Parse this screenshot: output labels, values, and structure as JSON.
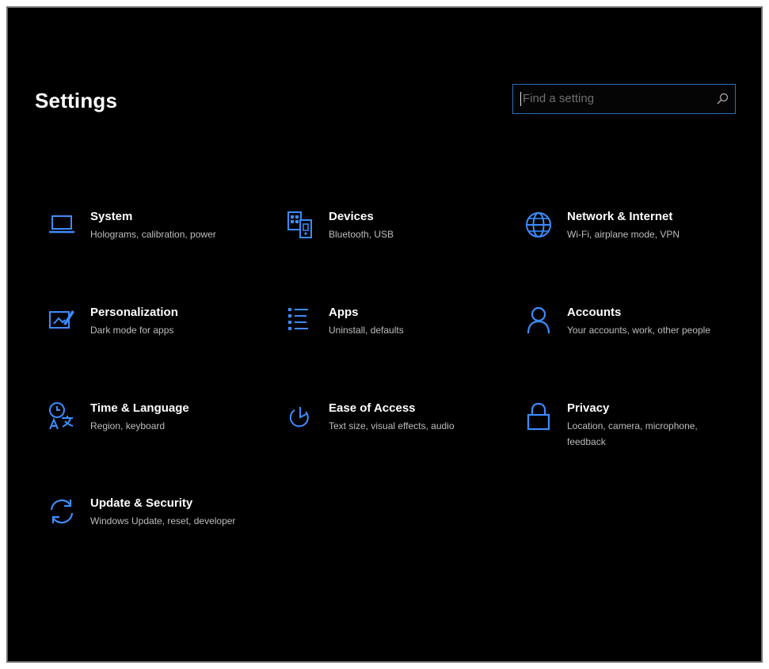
{
  "app": {
    "title": "Settings"
  },
  "search": {
    "placeholder": "Find a setting",
    "value": ""
  },
  "colors": {
    "accent": "#3c8cff",
    "background": "#000000",
    "text": "#ffffff",
    "subtext": "#bdbdbd"
  },
  "tiles": [
    {
      "label": "System",
      "desc": "Holograms, calibration, power",
      "icon": "laptop-icon"
    },
    {
      "label": "Devices",
      "desc": "Bluetooth, USB",
      "icon": "devices-icon"
    },
    {
      "label": "Network & Internet",
      "desc": "Wi-Fi, airplane mode, VPN",
      "icon": "globe-icon"
    },
    {
      "label": "Personalization",
      "desc": "Dark mode for apps",
      "icon": "personalization-icon"
    },
    {
      "label": "Apps",
      "desc": "Uninstall, defaults",
      "icon": "apps-list-icon"
    },
    {
      "label": "Accounts",
      "desc": "Your accounts, work, other people",
      "icon": "person-icon"
    },
    {
      "label": "Time & Language",
      "desc": "Region, keyboard",
      "icon": "time-language-icon"
    },
    {
      "label": "Ease of Access",
      "desc": "Text size, visual effects, audio",
      "icon": "ease-of-access-icon"
    },
    {
      "label": "Privacy",
      "desc": "Location, camera, microphone, feedback",
      "icon": "lock-icon"
    },
    {
      "label": "Update & Security",
      "desc": "Windows Update, reset, developer",
      "icon": "sync-icon"
    }
  ]
}
